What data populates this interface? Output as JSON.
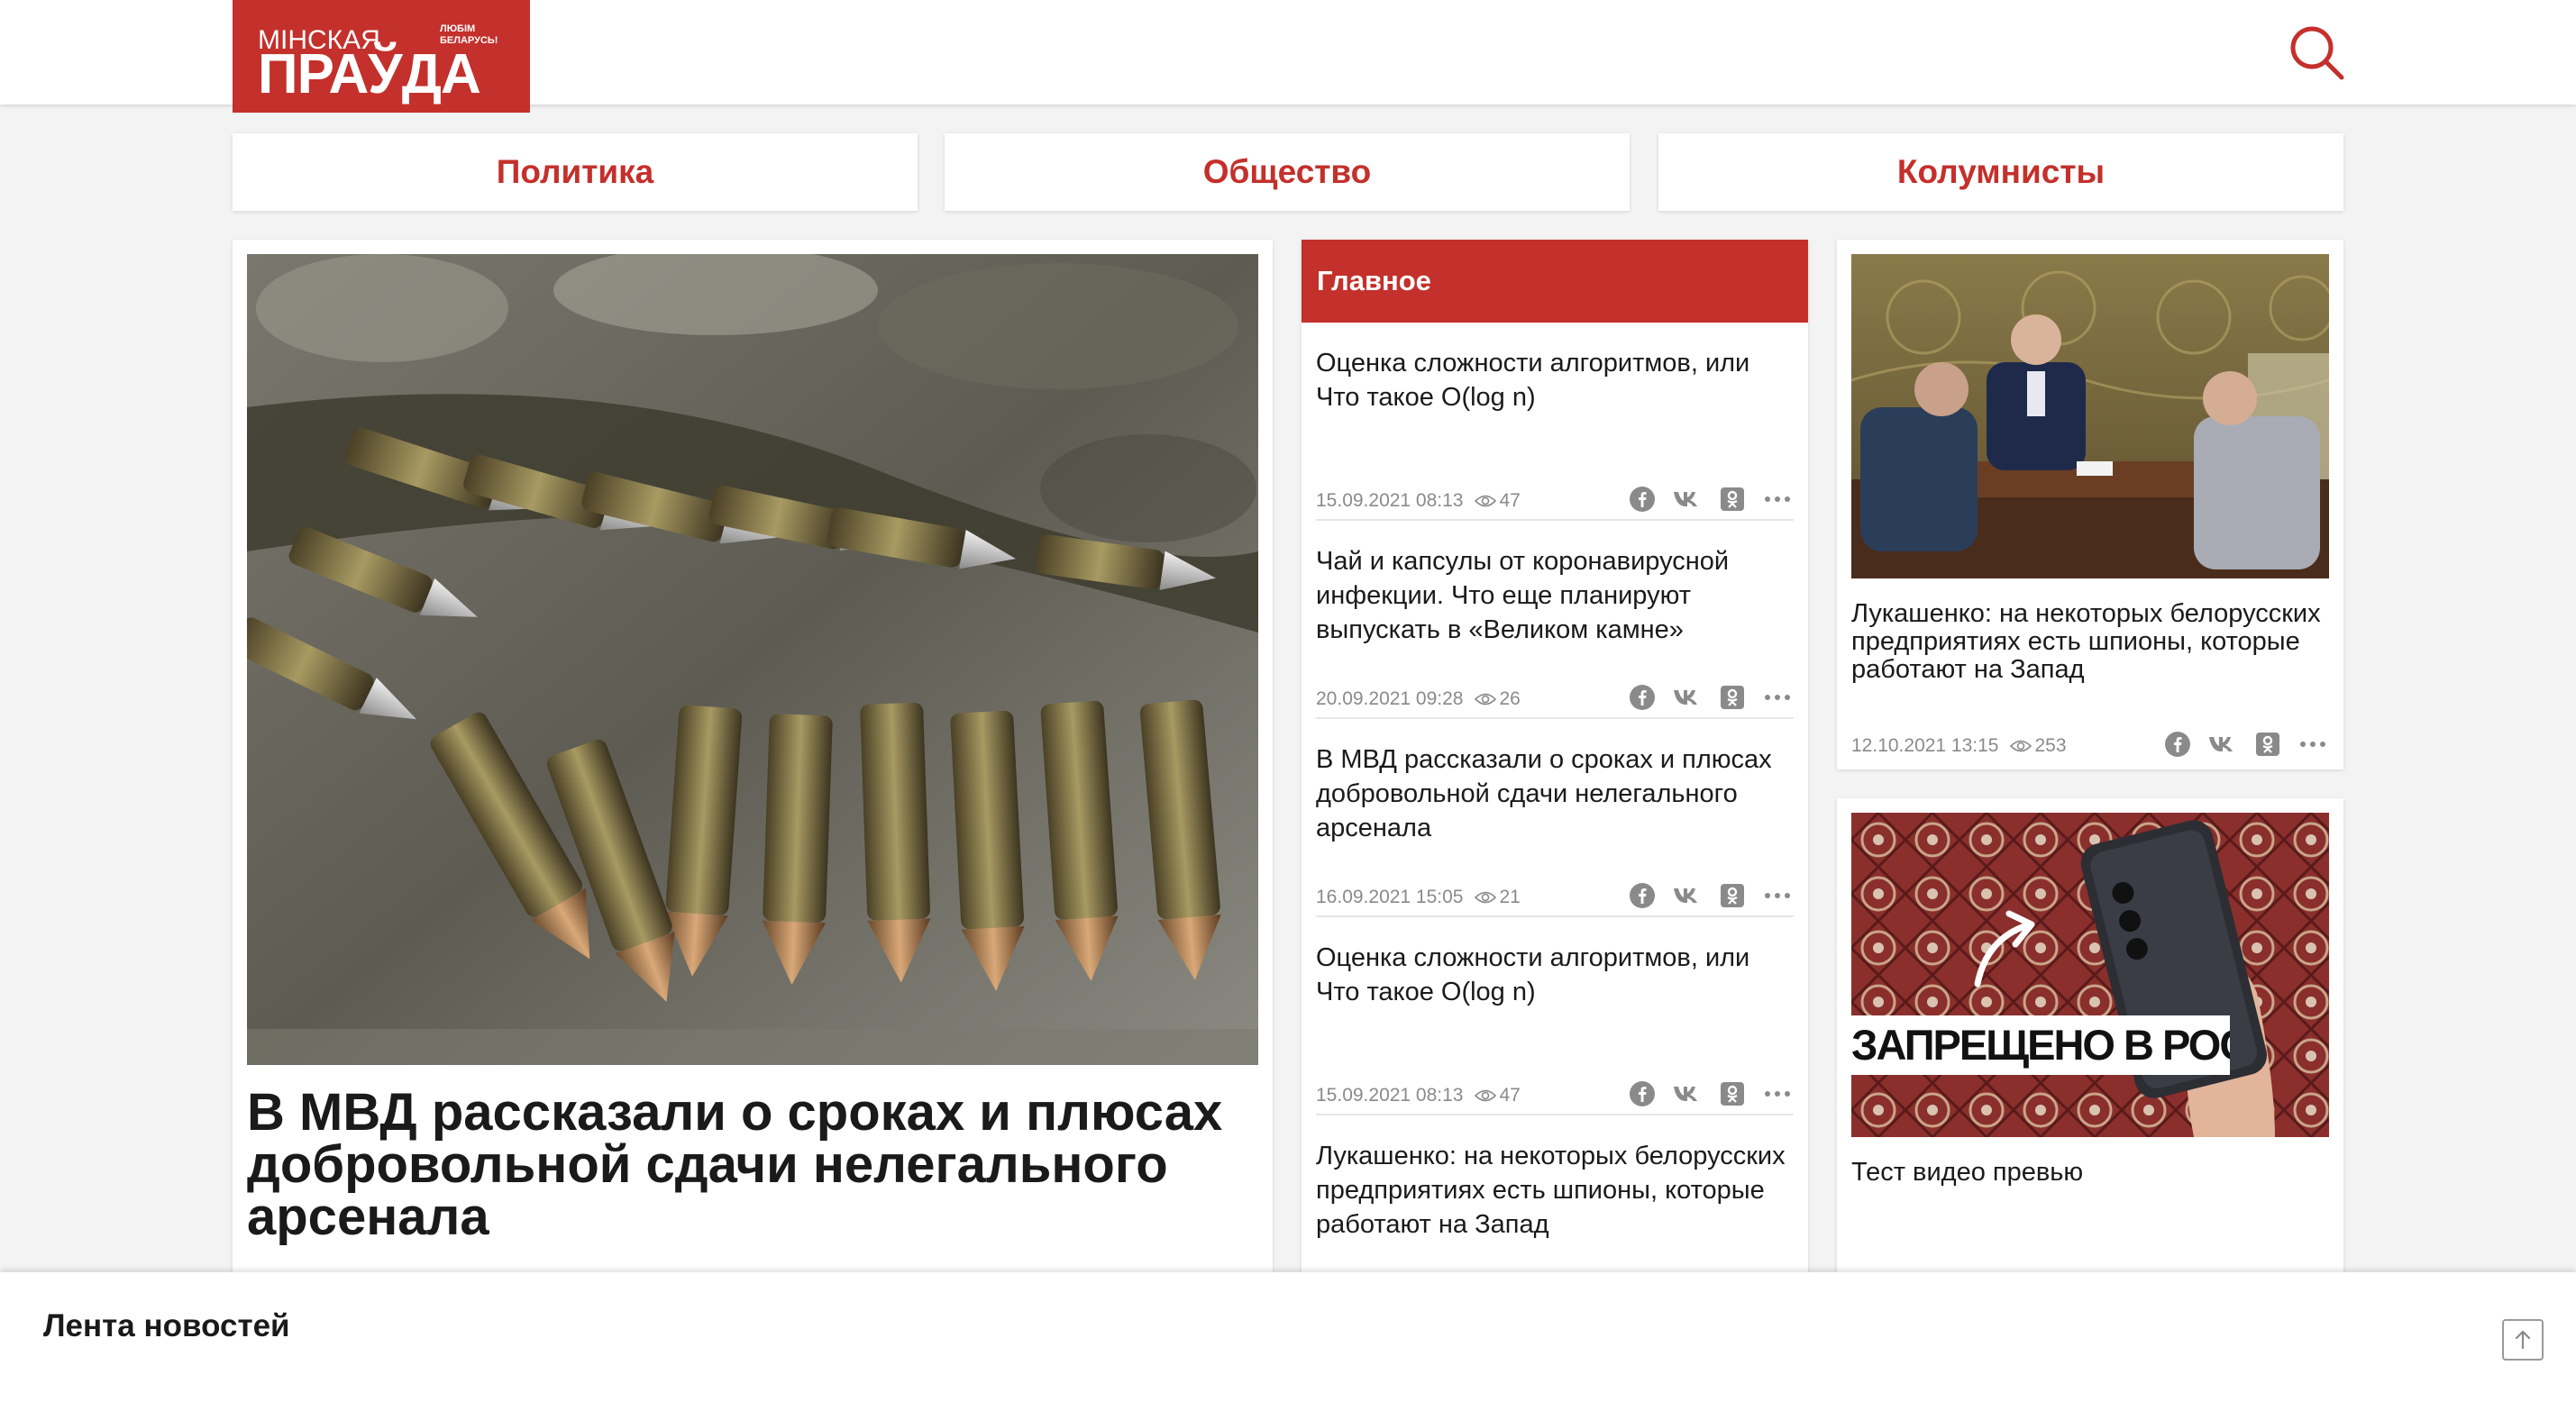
{
  "header": {
    "logo_line1": "МІНСКАЯ",
    "logo_line2": "ПРАЎДА",
    "logo_tagline": "ЛЮБІМ БЕЛАРУСЬ!"
  },
  "nav": {
    "items": [
      {
        "label": "Политика"
      },
      {
        "label": "Общество"
      },
      {
        "label": "Колумнисты"
      }
    ]
  },
  "main_article": {
    "title": "В МВД рассказали о сроках и плюсах добровольной сдачи нелегального арсенала"
  },
  "main_column": {
    "heading": "Главное",
    "items": [
      {
        "title": "Оценка сложности алгоритмов, или Что такое О(log n)",
        "date": "15.09.2021 08:13",
        "views": "47"
      },
      {
        "title": "Чай и капсулы от коронавирусной инфекции. Что еще планируют выпускать в «Великом камне»",
        "date": "20.09.2021 09:28",
        "views": "26"
      },
      {
        "title": "В МВД рассказали о сроках и плюсах добровольной сдачи нелегального арсенала",
        "date": "16.09.2021 15:05",
        "views": "21"
      },
      {
        "title": "Оценка сложности алгоритмов, или Что такое О(log n)",
        "date": "15.09.2021 08:13",
        "views": "47"
      },
      {
        "title": "Лукашенко: на некоторых белорусских предприятиях есть шпионы, которые работают на Запад"
      }
    ]
  },
  "right_column": {
    "card1": {
      "title": "Лукашенко: на некоторых белорусских предприятиях есть шпионы, которые работают на Запад",
      "date": "12.10.2021 13:15",
      "views": "253"
    },
    "card2": {
      "title": "Тест видео превью",
      "overlay_text": "ЗАПРЕЩЕНО В РОССИИ"
    }
  },
  "feed": {
    "title": "Лента новостей"
  },
  "colors": {
    "brand_red": "#c4302b",
    "text": "#1a1a1a",
    "meta_gray": "#8a8a8a"
  },
  "icons": [
    "search-icon",
    "eye-icon",
    "facebook-icon",
    "vk-icon",
    "odnoklassniki-icon",
    "more-icon",
    "arrow-up-icon"
  ]
}
